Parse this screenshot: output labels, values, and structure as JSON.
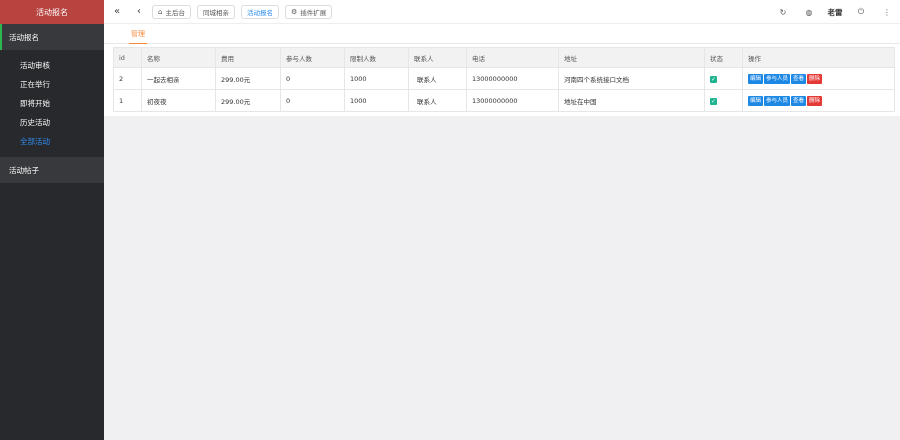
{
  "app": {
    "title": "活动报名"
  },
  "sidebar": {
    "groups": [
      {
        "label": "活动报名",
        "items": [
          {
            "label": "活动审核"
          },
          {
            "label": "正在举行"
          },
          {
            "label": "即将开始"
          },
          {
            "label": "历史活动"
          },
          {
            "label": "全部活动"
          }
        ]
      },
      {
        "label": "活动帖子"
      }
    ]
  },
  "topbar": {
    "tabs": [
      {
        "label": "主后台",
        "icon": "home-icon"
      },
      {
        "label": "同城相亲"
      },
      {
        "label": "活动报名"
      },
      {
        "label": "插件扩展",
        "icon": "plugin-icon"
      }
    ],
    "username": "老雷"
  },
  "main": {
    "subtab": "管理",
    "table": {
      "columns": [
        "id",
        "名称",
        "费用",
        "参与人数",
        "限制人数",
        "联系人",
        "电话",
        "地址",
        "状态",
        "操作"
      ],
      "rows": [
        {
          "id": "2",
          "name": "一起去相亲",
          "fee": "299.00元",
          "participants": "0",
          "limit": "1000",
          "contact": "联系人",
          "phone": "13000000000",
          "address": "河南四个系统接口文档",
          "status": "checked"
        },
        {
          "id": "1",
          "name": "初夜夜",
          "fee": "299.00元",
          "participants": "0",
          "limit": "1000",
          "contact": "联系人",
          "phone": "13000000000",
          "address": "地址在中国",
          "status": "checked"
        }
      ],
      "actions": {
        "edit": "编辑",
        "participants": "参与人员",
        "view": "查看",
        "delete": "删除"
      }
    }
  },
  "colors": {
    "brand": "#b8443f",
    "accent": "#2d8cf0",
    "tab_active": "#f5883b",
    "check": "#1fb48f"
  }
}
